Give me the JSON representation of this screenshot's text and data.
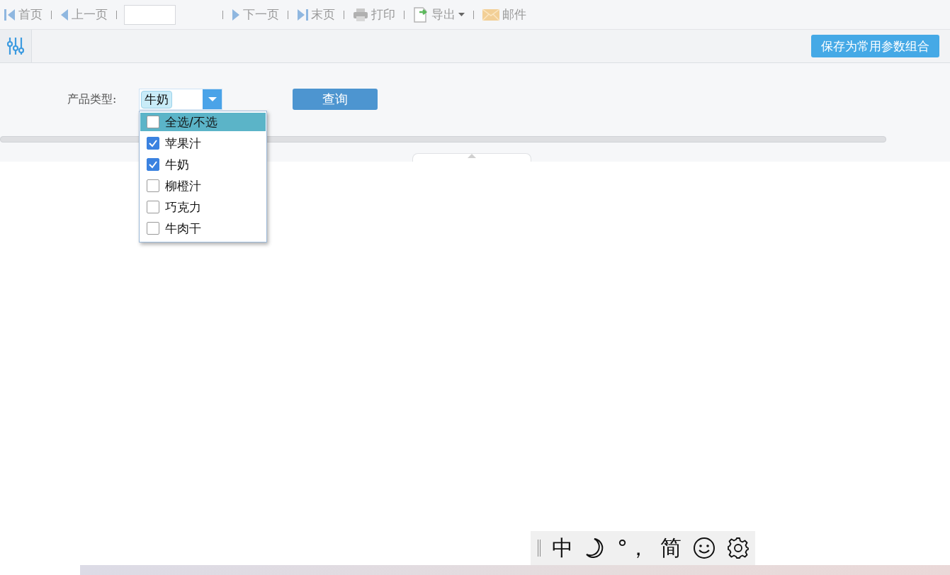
{
  "toolbar": {
    "items": [
      {
        "kind": "first",
        "label": "首页"
      },
      {
        "kind": "prev",
        "label": "上一页"
      },
      {
        "kind": "page_input"
      },
      {
        "kind": "next",
        "label": "下一页"
      },
      {
        "kind": "last",
        "label": "末页"
      },
      {
        "kind": "print",
        "label": "打印"
      },
      {
        "kind": "export",
        "label": "导出"
      },
      {
        "kind": "mail",
        "label": "邮件"
      }
    ]
  },
  "param_bar": {
    "save_button": "保存为常用参数组合"
  },
  "filter": {
    "label": "产品类型:",
    "tags": [
      "牛奶"
    ],
    "query_button": "查询",
    "options": [
      {
        "label": "全选/不选",
        "checked": false,
        "selected": true
      },
      {
        "label": "苹果汁",
        "checked": true,
        "selected": false
      },
      {
        "label": "牛奶",
        "checked": true,
        "selected": false
      },
      {
        "label": "柳橙汁",
        "checked": false,
        "selected": false
      },
      {
        "label": "巧克力",
        "checked": false,
        "selected": false
      },
      {
        "label": "牛肉干",
        "checked": false,
        "selected": false
      }
    ]
  },
  "ime_bar": {
    "items": [
      {
        "kind": "text",
        "label": "中"
      },
      {
        "kind": "moon"
      },
      {
        "kind": "text",
        "label": "°，"
      },
      {
        "kind": "text",
        "label": "简"
      },
      {
        "kind": "smiley"
      },
      {
        "kind": "gear"
      }
    ]
  }
}
